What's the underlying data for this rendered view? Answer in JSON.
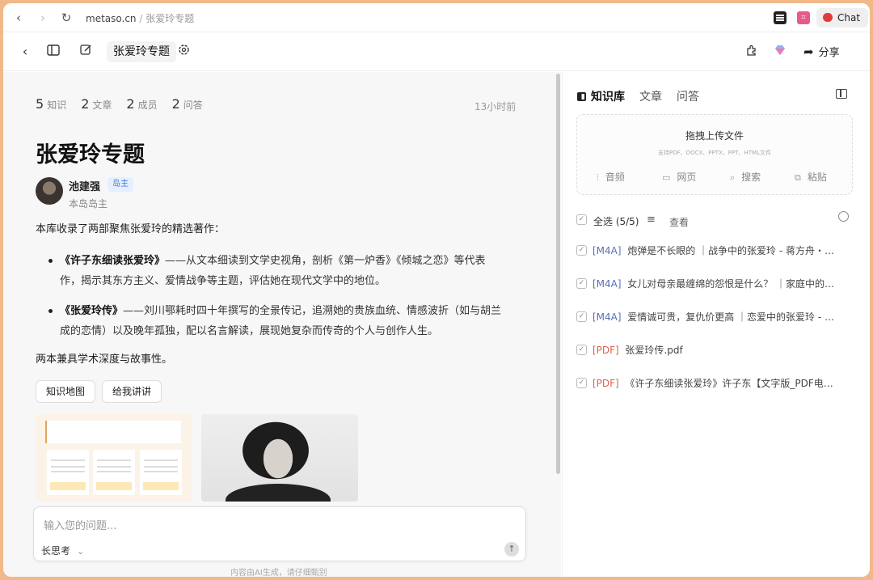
{
  "browser": {
    "url_domain": "metaso.cn",
    "url_sep": " / ",
    "url_path": "张爱玲专题",
    "chat_label": "Chat"
  },
  "header": {
    "title": "张爱玲专题",
    "share_label": "分享"
  },
  "stats": [
    {
      "count": "5",
      "label": "知识"
    },
    {
      "count": "2",
      "label": "文章"
    },
    {
      "count": "2",
      "label": "成员"
    },
    {
      "count": "2",
      "label": "问答"
    }
  ],
  "updated": "13小时前",
  "page_title": "张爱玲专题",
  "author": {
    "name": "池建强",
    "badge": "岛主",
    "role": "本岛岛主"
  },
  "intro": "本库收录了两部聚焦张爱玲的精选著作：",
  "books": [
    {
      "title": "《许子东细读张爱玲》",
      "line1": "——从文本细读到文学史视角，剖析《第一炉香》《倾城之恋》等代表",
      "line2": "作，揭示其东方主义、爱情战争等主题，评估她在现代文学中的地位。"
    },
    {
      "title": "《张爱玲传》",
      "line1": "——刘川鄂耗时四十年撰写的全景传记，追溯她的贵族血统、情感波折（如与胡兰",
      "line2": "成的恋情）以及晚年孤独，配以名言解读，展现她复杂而传奇的个人与创作人生。"
    }
  ],
  "conclusion": "两本兼具学术深度与故事性。",
  "actions": {
    "map": "知识地图",
    "explain": "给我讲讲"
  },
  "input": {
    "placeholder": "输入您的问题...",
    "mode": "长思考"
  },
  "disclaimer": "内容由AI生成，请仔细甄别",
  "right": {
    "tabs": [
      "知识库",
      "文章",
      "问答"
    ],
    "upload_title": "拖拽上传文件",
    "upload_sub": "支持PDF、DOCX、PPTX、PPT、HTML文件",
    "upload_options": [
      "音频",
      "网页",
      "搜索",
      "粘贴"
    ],
    "select_all": "全选 (5/5)",
    "view": "查看",
    "files": [
      {
        "tag": "[M4A]",
        "name": "炮弹是不长眼的 ｜战争中的张爱玲 - 蒋方舟・一…"
      },
      {
        "tag": "[M4A]",
        "name": "女儿对母亲最缠绵的怨恨是什么？ ｜家庭中的…"
      },
      {
        "tag": "[M4A]",
        "name": "爱情诚可贵，复仇价更高 ｜恋爱中的张爱玲 - 蒋…"
      },
      {
        "tag": "[PDF]",
        "name": "张爱玲传.pdf"
      },
      {
        "tag": "[PDF]",
        "name": "《许子东细读张爱玲》许子东【文字版_PDF电…"
      }
    ]
  },
  "colors": {
    "accent": "#3a7bd5",
    "m4a": "#5a6fb8",
    "pdf": "#e0604c",
    "frame": "#f1b98a"
  }
}
